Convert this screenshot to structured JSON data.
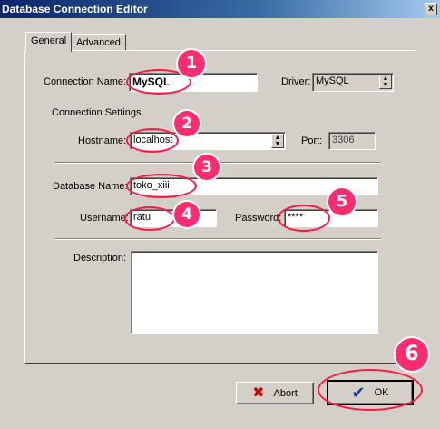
{
  "window": {
    "title": "Database Connection Editor",
    "close_glyph": "x"
  },
  "tabs": [
    {
      "label": "General"
    },
    {
      "label": "Advanced"
    }
  ],
  "general": {
    "connection_name_label": "Connection Name:",
    "connection_name_value": "MySQL",
    "driver_label": "Driver:",
    "driver_value": "MySQL"
  },
  "connection_settings": {
    "title": "Connection Settings",
    "hostname_label": "Hostname:",
    "hostname_value": "localhost",
    "port_label": "Port:",
    "port_value": "3306",
    "database_label": "Database Name:",
    "database_value": "toko_xiii",
    "username_label": "Username:",
    "username_value": "ratu",
    "password_label": "Password:",
    "password_value": "****",
    "description_label": "Description:",
    "description_value": ""
  },
  "buttons": {
    "abort_label": "Abort",
    "ok_label": "OK"
  },
  "annotations": [
    "1",
    "2",
    "3",
    "4",
    "5",
    "6"
  ],
  "colors": {
    "titlebar": "#0a246a",
    "face": "#d4d0c8",
    "marker": "#ff1744",
    "badge": "#ff2d6f"
  }
}
